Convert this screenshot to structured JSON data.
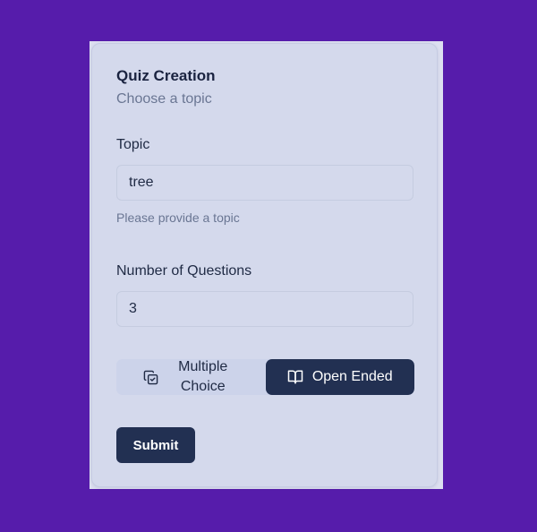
{
  "card": {
    "title": "Quiz Creation",
    "subtitle": "Choose a topic"
  },
  "topic": {
    "label": "Topic",
    "value": "tree",
    "hint": "Please provide a topic"
  },
  "questions": {
    "label": "Number of Questions",
    "value": "3"
  },
  "quiz_type": {
    "options": [
      {
        "label": "Multiple Choice",
        "icon": "copy-check-icon",
        "selected": false
      },
      {
        "label": "Open Ended",
        "icon": "book-open-icon",
        "selected": true
      }
    ]
  },
  "submit_label": "Submit",
  "colors": {
    "background": "#561cab",
    "card": "#d4d9ec",
    "primary": "#223052",
    "muted_text": "#6a7693"
  }
}
